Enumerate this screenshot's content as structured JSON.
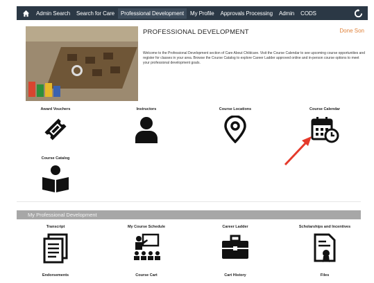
{
  "nav": {
    "home_icon": "home-icon",
    "items": [
      {
        "label": "Admin Search"
      },
      {
        "label": "Search for Care"
      },
      {
        "label": "Professional Development"
      },
      {
        "label": "My Profile"
      },
      {
        "label": "Approvals Processing"
      },
      {
        "label": "Admin"
      },
      {
        "label": "CODS"
      }
    ],
    "active_index": 2,
    "refresh_icon": "refresh-icon",
    "bar_color": "#2b3845"
  },
  "header": {
    "title": "PROFESSIONAL DEVELOPMENT",
    "done_link": "Done Son",
    "welcome_text": "Welcome to the Professional Development section of Care About Childcare. Visit the Course Calendar to see upcoming course opportunities and register for classes in your area. Browse the Course Catalog to explore Career Ladder approved online and in-person course options to meet your professional development goals.",
    "accent_color": "#e0823a"
  },
  "tiles_top": [
    {
      "label": "Award Vouchers",
      "icon": "voucher-ticket-icon"
    },
    {
      "label": "Instructors",
      "icon": "person-icon"
    },
    {
      "label": "Course Locations",
      "icon": "map-pin-icon"
    },
    {
      "label": "Course Calendar",
      "icon": "calendar-clock-icon"
    },
    {
      "label": "Course Catalog",
      "icon": "book-reader-icon"
    }
  ],
  "section": {
    "title": "My Professional Development"
  },
  "tiles_bottom": [
    {
      "label": "Transcript",
      "icon": "transcript-document-icon"
    },
    {
      "label": "My Course Schedule",
      "icon": "classroom-presentation-icon"
    },
    {
      "label": "Career Ladder",
      "icon": "briefcase-icon"
    },
    {
      "label": "Scholarships and Incentives",
      "icon": "certificate-icon"
    },
    {
      "label": "Endorsements",
      "icon": ""
    },
    {
      "label": "Course Cart",
      "icon": ""
    },
    {
      "label": "Cart History",
      "icon": ""
    },
    {
      "label": "Files",
      "icon": ""
    }
  ],
  "annotation": {
    "arrow_color": "#e53a2b",
    "arrow_icon": "red-arrow-annotation"
  }
}
